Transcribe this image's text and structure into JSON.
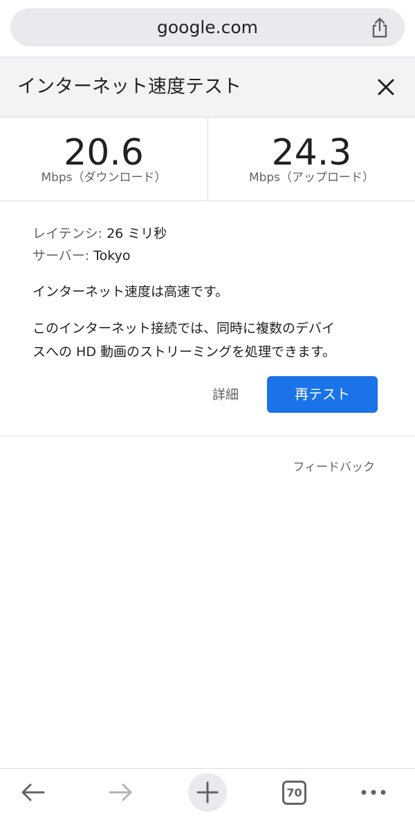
{
  "address_bar": {
    "url": "google.com"
  },
  "header": {
    "title": "インターネット速度テスト"
  },
  "speeds": {
    "download": {
      "value": "20.6",
      "unit": "Mbps（ダウンロード）"
    },
    "upload": {
      "value": "24.3",
      "unit": "Mbps（アップロード）"
    }
  },
  "details": {
    "latency_label": "レイテンシ:",
    "latency_value": "26 ミリ秒",
    "server_label": "サーバー:",
    "server_value": "Tokyo",
    "summary": "インターネット速度は高速です。",
    "description_line1": "このインターネット接続では、同時に複数のデバイ",
    "description_line2": "スへの HD 動画のストリーミングを処理できます。"
  },
  "actions": {
    "details_label": "詳細",
    "retest_label": "再テスト"
  },
  "feedback_label": "フィードバック",
  "toolbar": {
    "tab_count": "70",
    "icons": [
      "back-arrow-icon",
      "forward-arrow-icon",
      "plus-icon",
      "tab-switcher-icon",
      "more-dots-icon"
    ]
  },
  "colors": {
    "accent": "#1a73e8",
    "header_bg": "#f1f3f4",
    "pill_bg": "#e8eaed"
  }
}
